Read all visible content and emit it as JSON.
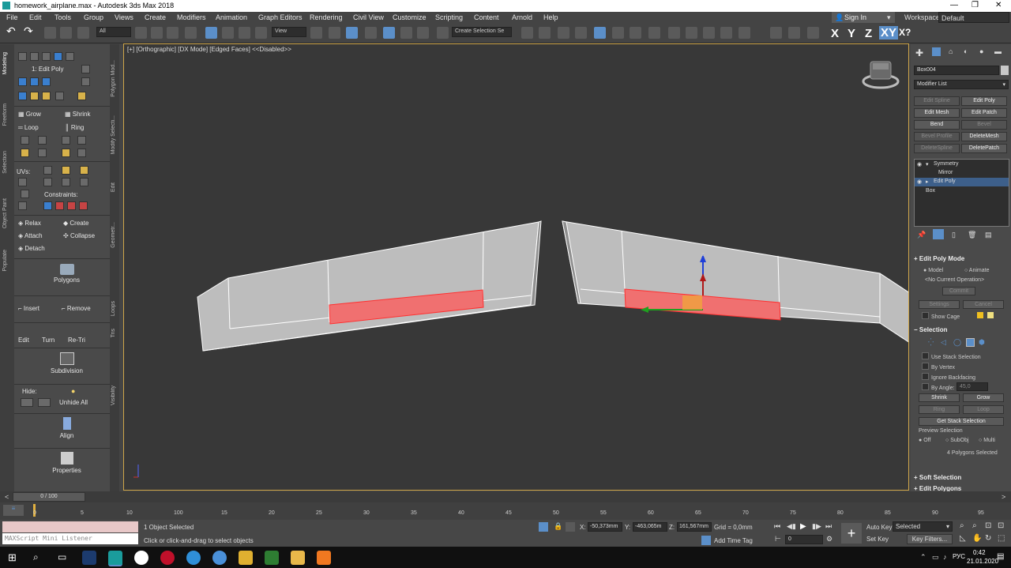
{
  "window": {
    "title": "homework_airplane.max - Autodesk 3ds Max 2018"
  },
  "menu": [
    "File",
    "Edit",
    "Tools",
    "Group",
    "Views",
    "Create",
    "Modifiers",
    "Animation",
    "Graph Editors",
    "Rendering",
    "Civil View",
    "Customize",
    "Scripting",
    "Content",
    "Arnold",
    "Help"
  ],
  "account": {
    "sign_in": "Sign In",
    "workspaces_label": "Workspaces:",
    "workspace": "Default"
  },
  "toolbar": {
    "selection_filter": "All",
    "ref_coord": "View",
    "named_selection": "Create Selection Se",
    "axes": [
      "X",
      "Y",
      "Z",
      "XY"
    ]
  },
  "left_tabs": [
    "Modeling",
    "Freeform",
    "Selection",
    "Object Paint",
    "Populate"
  ],
  "ribbon": {
    "modifier_label": "1: Edit Poly",
    "grow": "Grow",
    "shrink": "Shrink",
    "loop": "Loop",
    "ring": "Ring",
    "uvs": "UVs:",
    "constraints": "Constraints:",
    "relax": "Relax",
    "create": "Create",
    "attach": "Attach",
    "collapse": "Collapse",
    "detach": "Detach",
    "polygons": "Polygons",
    "insert": "Insert",
    "remove": "Remove",
    "edit": "Edit",
    "turn": "Turn",
    "retri": "Re-Tri",
    "subdivision": "Subdivision",
    "hide": "Hide:",
    "unhide_all": "Unhide All",
    "align": "Align",
    "properties": "Properties",
    "side_labels": [
      "Polygon Mod...",
      "Modify Selecti...",
      "Edit",
      "Geometr...",
      "Loops",
      "Tris",
      "Visibility"
    ]
  },
  "viewport": {
    "label": "[+] [Orthographic] [DX Mode] [Edged Faces]  <<Disabled>>"
  },
  "command_panel": {
    "object_name": "Box004",
    "modifier_list": "Modifier List",
    "modifier_buttons": [
      {
        "label": "Edit Spline",
        "enabled": false
      },
      {
        "label": "Edit Poly",
        "enabled": true
      },
      {
        "label": "Edit Mesh",
        "enabled": true
      },
      {
        "label": "Edit Patch",
        "enabled": true
      },
      {
        "label": "Bend",
        "enabled": true
      },
      {
        "label": "Bevel",
        "enabled": false
      },
      {
        "label": "Bevel Profile",
        "enabled": false
      },
      {
        "label": "DeleteMesh",
        "enabled": true
      },
      {
        "label": "DeleteSpline",
        "enabled": false
      },
      {
        "label": "DeletePatch",
        "enabled": true
      }
    ],
    "stack": [
      "Symmetry",
      "Mirror",
      "Edit Poly",
      "Box"
    ],
    "edit_poly_mode": {
      "title": "Edit Poly Mode",
      "model": "Model",
      "animate": "Animate",
      "no_op": "<No Current Operation>",
      "commit": "Commit",
      "settings": "Settings",
      "cancel": "Cancel",
      "show_cage": "Show Cage"
    },
    "selection": {
      "title": "Selection",
      "use_stack": "Use Stack Selection",
      "by_vertex": "By Vertex",
      "ignore_backfacing": "Ignore Backfacing",
      "by_angle": "By Angle:",
      "angle_value": "45,0",
      "shrink": "Shrink",
      "grow": "Grow",
      "ring": "Ring",
      "loop": "Loop",
      "get_stack": "Get Stack Selection",
      "preview": "Preview Selection",
      "off": "Off",
      "subobj": "SubObj",
      "multi": "Multi",
      "status": "4 Polygons Selected"
    },
    "soft_selection": "Soft Selection",
    "edit_polygons": "Edit Polygons"
  },
  "timeline": {
    "frame": "0 / 100",
    "ticks": [
      "0",
      "5",
      "10",
      "15",
      "20",
      "25",
      "30",
      "35",
      "40",
      "45",
      "50",
      "55",
      "60",
      "65",
      "70",
      "75",
      "80",
      "85",
      "90",
      "95",
      "100"
    ]
  },
  "status": {
    "listener": "MAXScript Mini Listener",
    "objects_selected": "1 Object Selected",
    "prompt": "Click or click-and-drag to select objects",
    "x": "-50,373mm",
    "y": "-463,065m",
    "z": "161,567mm",
    "grid": "Grid = 0,0mm",
    "add_time_tag": "Add Time Tag",
    "auto_key": "Auto Key",
    "set_key": "Set Key",
    "key_mode": "Selected",
    "key_filters": "Key Filters...",
    "frame_value": "0"
  },
  "taskbar": {
    "lang": "РУС",
    "time": "0:42",
    "date": "21.01.2020"
  },
  "colors": {
    "accent": "#5b8fc9",
    "viewport_border": "#cfa64a",
    "selected_face": "#f07070"
  }
}
